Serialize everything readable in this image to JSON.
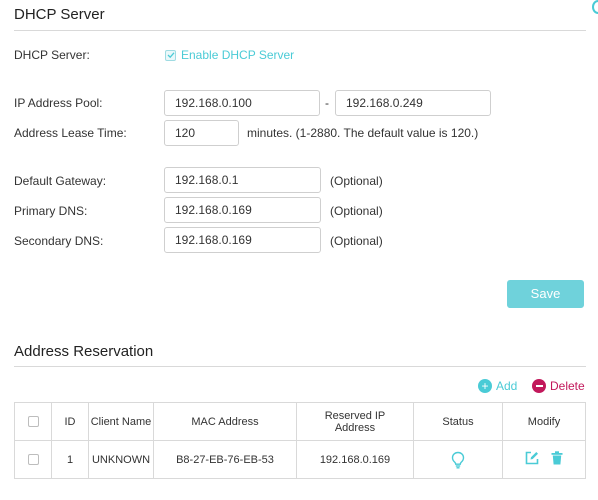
{
  "dhcp_section": {
    "title": "DHCP Server",
    "server_label": "DHCP Server:",
    "enable_label": "Enable DHCP Server",
    "enable_checked": true,
    "pool_label": "IP Address Pool:",
    "pool_start": "192.168.0.100",
    "pool_separator": "-",
    "pool_end": "192.168.0.249",
    "lease_label": "Address Lease Time:",
    "lease_value": "120",
    "lease_hint": "minutes. (1-2880. The default value is 120.)",
    "gateway_label": "Default Gateway:",
    "gateway_value": "192.168.0.1",
    "primary_dns_label": "Primary DNS:",
    "primary_dns_value": "192.168.0.169",
    "secondary_dns_label": "Secondary DNS:",
    "secondary_dns_value": "192.168.0.169",
    "optional_hint": "(Optional)",
    "save_label": "Save"
  },
  "reservation_section": {
    "title": "Address Reservation",
    "add_label": "Add",
    "delete_label": "Delete",
    "columns": [
      "ID",
      "Client Name",
      "MAC Address",
      "Reserved IP Address",
      "Status",
      "Modify"
    ],
    "rows": [
      {
        "id": "1",
        "client_name": "UNKNOWN",
        "mac": "B8-27-EB-76-EB-53",
        "reserved_ip": "192.168.0.169",
        "status_icon": "lightbulb-icon"
      }
    ]
  },
  "colors": {
    "accent": "#4acbd6",
    "save_button": "#6fd2db",
    "delete": "#c2185b",
    "border": "#d9d9d9"
  }
}
